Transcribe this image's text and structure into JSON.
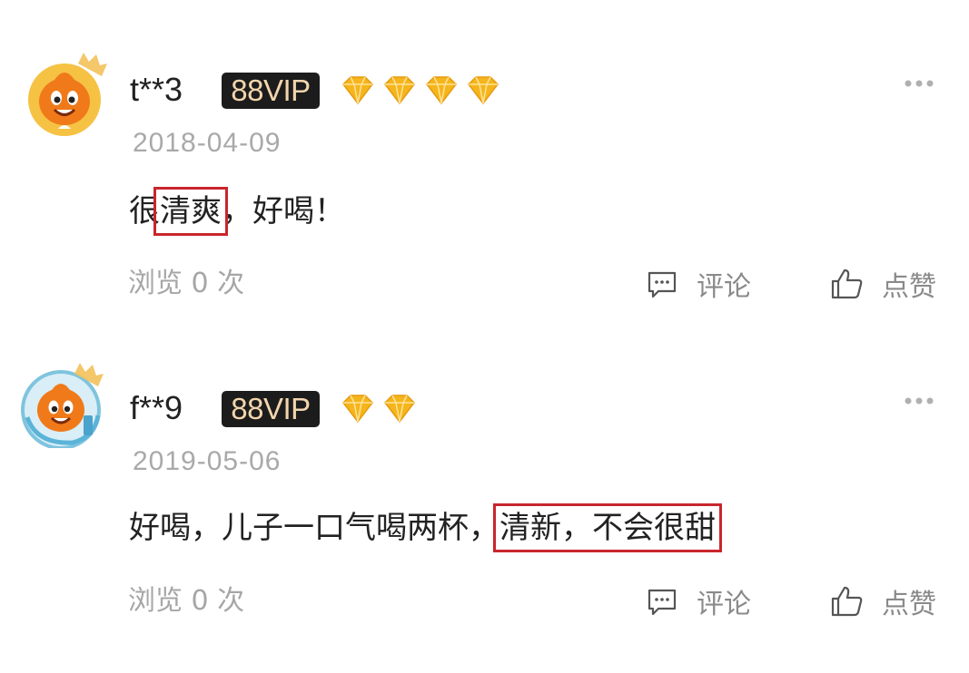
{
  "reviews": [
    {
      "username": "t**3",
      "vip": "88VIP",
      "diamond_count": 4,
      "date": "2018-04-09",
      "content": {
        "before": "很",
        "highlight": "清爽",
        "after": "，好喝！"
      },
      "views": "浏览 0 次",
      "comment_label": "评论",
      "like_label": "点赞"
    },
    {
      "username": "f**9",
      "vip": "88VIP",
      "diamond_count": 2,
      "date": "2019-05-06",
      "content": {
        "before": "好喝，儿子一口气喝两杯，",
        "highlight": "清新，不会很甜",
        "after": ""
      },
      "views": "浏览 0 次",
      "comment_label": "评论",
      "like_label": "点赞"
    }
  ],
  "colors": {
    "vip_bg": "#1c1c1c",
    "vip_text": "#f3d5ad",
    "diamond": "#f5b51c",
    "highlight_box": "#c8262c",
    "meta_text": "#a9a9a9"
  },
  "icons": {
    "more": "more-dots-icon",
    "comment": "comment-bubble-icon",
    "like": "thumbs-up-icon",
    "vip": "diamond-icon"
  }
}
